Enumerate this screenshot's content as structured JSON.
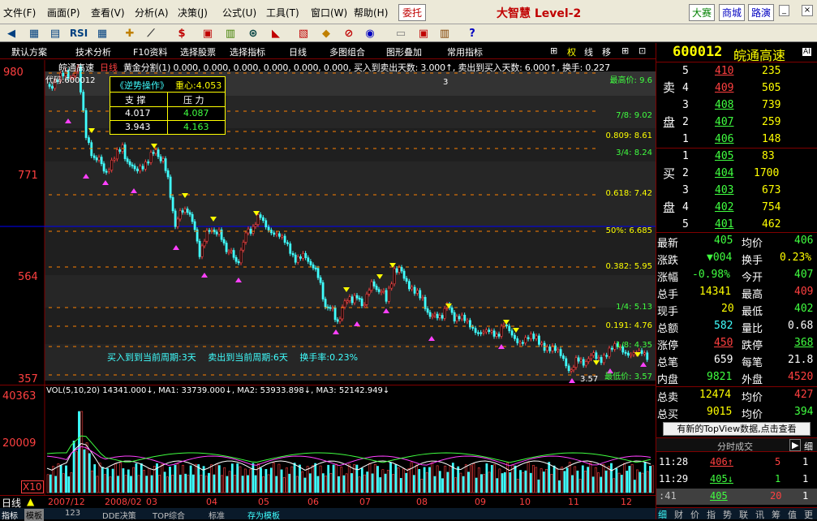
{
  "menu": [
    "文件(F)",
    "画面(P)",
    "查看(V)",
    "分析(A)",
    "决策(J)",
    "公式(U)",
    "工具(T)",
    "窗口(W)",
    "帮助(H)"
  ],
  "menu_right": {
    "weituo": "委托",
    "brand": "大智慧 Level-2",
    "dasai": "大赛",
    "shangcheng": "商城",
    "luyan": "路演"
  },
  "toolbar": {
    "rsi": "RSI",
    "dollar": "$"
  },
  "fnbar": [
    "默认方案",
    "技术分析",
    "F10资料",
    "选择股票",
    "选择指标",
    "日线",
    "多图组合",
    "图形叠加",
    "常用指标"
  ],
  "fnbar_right": [
    "权",
    "线",
    "移"
  ],
  "chart": {
    "header_name": "皖通高速",
    "header_period": "日线",
    "header_text": "黄金分割(1) 0.000, 0.000, 0.000, 0.000, 0.000, 0.000, 买入到卖出天数: 3.000↑, 卖出到买入天数: 6.000↑, 换手: 0.227",
    "code_label": "代码:600012",
    "ticks": [
      "980",
      "771",
      "564",
      "357"
    ],
    "panel_title": "《逆势操作》",
    "panel_center": "重心:4.053",
    "panel_h1": "支 撑",
    "panel_h2": "压 力",
    "panel_r1c1": "4.017",
    "panel_r1c2": "4.087",
    "panel_r2c1": "3.943",
    "panel_r2c2": "4.163",
    "fib": [
      "最高价: 9.6",
      "7/8: 9.02",
      "0.809: 8.61",
      "3/4: 8.24",
      "0.618: 7.42",
      "50%: 6.685",
      "0.382: 5.95",
      "1/4: 5.13",
      "0.191: 4.76",
      "1/8: 4.35",
      "最低价: 3.57"
    ],
    "low_label": "3.57",
    "marker_3": "3",
    "bottom_text": "买入到到当前周期:3天　 卖出到当前周期:6天　 换手率:0.23%"
  },
  "volume": {
    "header": "VOL(5,10,20) 14341.000↓, MA1: 33739.000↓, MA2: 53933.898↓, MA3: 52142.949↓",
    "ticks": [
      "40363",
      "20009"
    ],
    "x10": "X10",
    "colors": {
      "ma1": "#ffffff",
      "ma2": "#ff40ff",
      "ma3": "#40ff40"
    }
  },
  "dates": [
    "2007/12",
    "2008/02",
    "03",
    "04",
    "05",
    "06",
    "07",
    "08",
    "09",
    "10",
    "11",
    "12"
  ],
  "period_label": "日线",
  "tabs": [
    "指标",
    "模板",
    "123",
    "DDE决策",
    "TOP综合",
    "标准",
    "存为模板"
  ],
  "stock": {
    "code": "600012",
    "name": "皖通高速",
    "ai": "AI"
  },
  "sell": [
    {
      "lvl": "5",
      "price": "410",
      "vol": "235"
    },
    {
      "lvl": "4",
      "price": "409",
      "vol": "505"
    },
    {
      "lvl": "3",
      "price": "408",
      "vol": "739"
    },
    {
      "lvl": "2",
      "price": "407",
      "vol": "259"
    },
    {
      "lvl": "1",
      "price": "406",
      "vol": "148"
    }
  ],
  "buy": [
    {
      "lvl": "1",
      "price": "405",
      "vol": "83"
    },
    {
      "lvl": "2",
      "price": "404",
      "vol": "1700"
    },
    {
      "lvl": "3",
      "price": "403",
      "vol": "673"
    },
    {
      "lvl": "4",
      "price": "402",
      "vol": "754"
    },
    {
      "lvl": "5",
      "price": "401",
      "vol": "462"
    }
  ],
  "sell_side": [
    "卖",
    "盘"
  ],
  "buy_side": [
    "买",
    "盘"
  ],
  "stats": [
    {
      "l1": "最新",
      "v1": "405",
      "l2": "均价",
      "v2": "406"
    },
    {
      "l1": "涨跌",
      "v1": "▼004",
      "l2": "换手",
      "v2": "0.23%"
    },
    {
      "l1": "涨幅",
      "v1": "-0.98%",
      "l2": "今开",
      "v2": "407"
    },
    {
      "l1": "总手",
      "v1": "14341",
      "l2": "最高",
      "v2": "409"
    },
    {
      "l1": "现手",
      "v1": "20",
      "l2": "最低",
      "v2": "402"
    },
    {
      "l1": "总额",
      "v1": "582",
      "l2": "量比",
      "v2": "0.68"
    },
    {
      "l1": "涨停",
      "v1": "450",
      "l2": "跌停",
      "v2": "368"
    },
    {
      "l1": "总笔",
      "v1": "659",
      "l2": "每笔",
      "v2": "21.8"
    },
    {
      "l1": "内盘",
      "v1": "9821",
      "l2": "外盘",
      "v2": "4520"
    }
  ],
  "totals": [
    {
      "l1": "总卖",
      "v1": "12474",
      "l2": "均价",
      "v2": "427"
    },
    {
      "l1": "总买",
      "v1": "9015",
      "l2": "均价",
      "v2": "394"
    }
  ],
  "topview": "有新的TopView数据,点击查看",
  "trades_title": "分时成交",
  "trades_btn": "细",
  "trades": [
    {
      "t": "11:28",
      "p": "406↑",
      "v": "5",
      "n": "1"
    },
    {
      "t": "11:29",
      "p": "405↓",
      "v": "1",
      "n": "1"
    },
    {
      "t": ":41",
      "p": "405",
      "v": "20",
      "n": "1"
    }
  ],
  "right_tabs": [
    "细",
    "财",
    "价",
    "指",
    "势",
    "联",
    "讯",
    "筹",
    "值",
    "更"
  ],
  "colors": {
    "up": "#ff4040",
    "down": "#40ffff",
    "green": "#40ff40",
    "yellow": "#ffff00",
    "fib_line": "#ff8000"
  }
}
